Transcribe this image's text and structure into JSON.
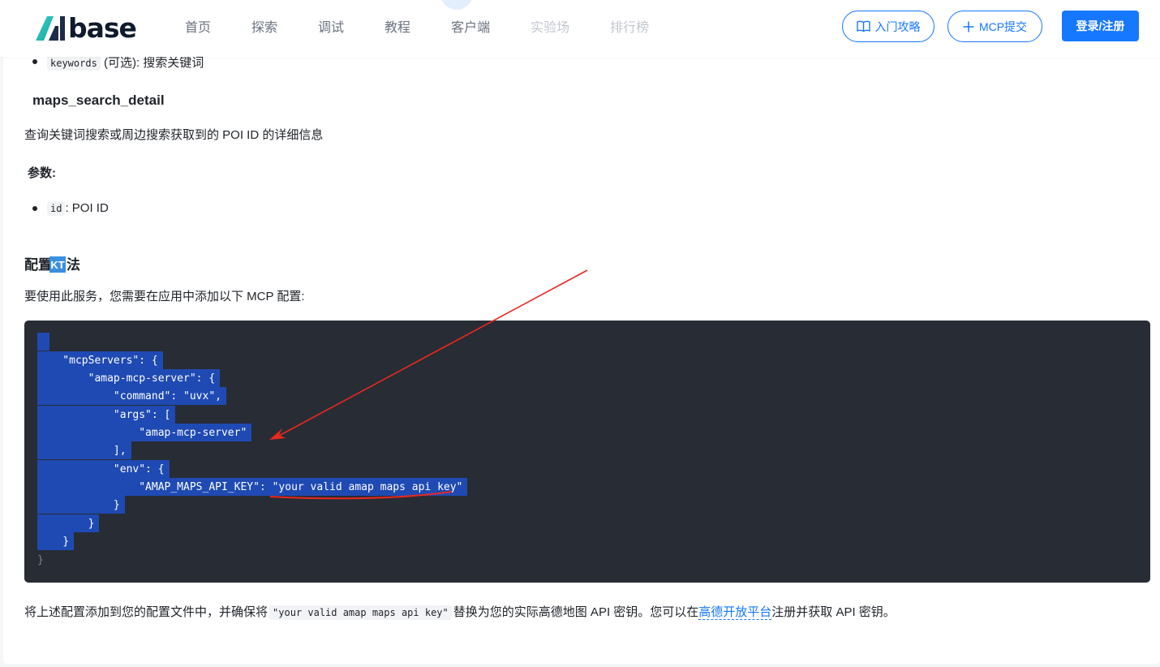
{
  "header": {
    "logo_text": "base",
    "nav": [
      "首页",
      "探索",
      "调试",
      "教程",
      "客户端",
      "实验场",
      "排行榜"
    ],
    "guide_label": "入门攻略",
    "mcp_label": "MCP提交",
    "login_label": "登录/注册"
  },
  "content": {
    "prev_param_name": "keywords",
    "prev_param_desc": " (可选): 搜索关键词",
    "section_title": "maps_search_detail",
    "section_desc": "查询关键词搜索或周边搜索获取到的 POI ID 的详细信息",
    "params_label": "参数:",
    "param_name": "id",
    "param_desc": ": POI ID",
    "config_title_a": "配置",
    "config_title_b": "法",
    "badge_text": "KT",
    "config_desc": "要使用此服务，您需要在应用中添加以下 MCP 配置:",
    "code_lines": [
      "{",
      "    \"mcpServers\": {",
      "        \"amap-mcp-server\": {",
      "            \"command\": \"uvx\",",
      "            \"args\": [",
      "                \"amap-mcp-server\"",
      "            ],",
      "            \"env\": {",
      "                \"AMAP_MAPS_API_KEY\": \"your valid amap maps api key\"",
      "            }",
      "        }",
      "    }",
      "}"
    ],
    "footer_a": "将上述配置添加到您的配置文件中，并确保将",
    "footer_code": "\"your valid amap maps api key\"",
    "footer_b": "替换为您的实际高德地图 API 密钥。您可以在",
    "footer_link": "高德开放平台",
    "footer_c": "注册并获取 API 密钥。"
  },
  "colors": {
    "accent": "#1677ff",
    "code_bg": "#282c34",
    "selection": "#1f4ab3",
    "annotation": "#e8281e"
  }
}
